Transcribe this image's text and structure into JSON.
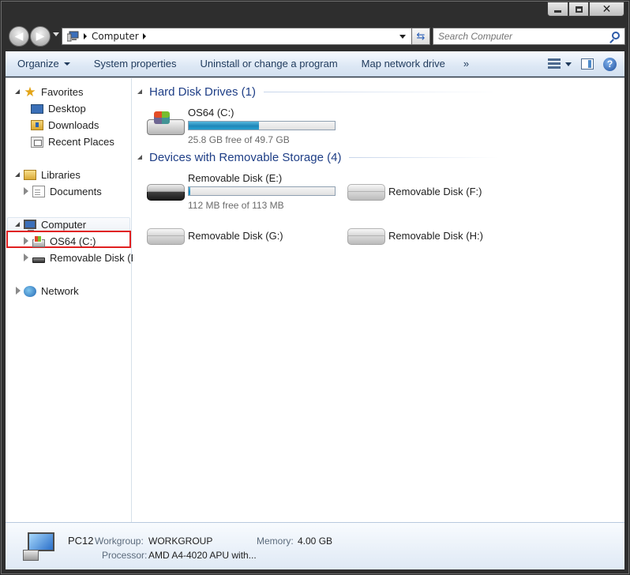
{
  "window": {
    "minimize_label": "",
    "maximize_label": "",
    "close_label": "✕"
  },
  "address": {
    "crumb": "Computer"
  },
  "search": {
    "placeholder": "Search Computer"
  },
  "toolbar": {
    "organize": "Organize",
    "system_properties": "System properties",
    "uninstall": "Uninstall or change a program",
    "map_drive": "Map network drive",
    "more": "»",
    "help": "?"
  },
  "nav": {
    "favorites": "Favorites",
    "desktop": "Desktop",
    "downloads": "Downloads",
    "recent": "Recent Places",
    "libraries": "Libraries",
    "documents": "Documents",
    "computer": "Computer",
    "os64": "OS64 (C:)",
    "removable_e": "Removable Disk (E:)",
    "network": "Network"
  },
  "groups": {
    "hdd": "Hard Disk Drives (1)",
    "removable": "Devices with Removable Storage (4)"
  },
  "drives": {
    "c": {
      "name": "OS64 (C:)",
      "free": "25.8 GB free of 49.7 GB",
      "used_fraction": 0.48
    },
    "e": {
      "name": "Removable Disk (E:)",
      "free": "112 MB free of 113 MB",
      "used_fraction": 0.01
    },
    "f": {
      "name": "Removable Disk (F:)"
    },
    "g": {
      "name": "Removable Disk (G:)"
    },
    "h": {
      "name": "Removable Disk (H:)"
    }
  },
  "details": {
    "pc_name": "PC12",
    "workgroup_label": "Workgroup:",
    "workgroup_value": "WORKGROUP",
    "memory_label": "Memory:",
    "memory_value": "4.00 GB",
    "processor_label": "Processor:",
    "processor_value": "AMD A4-4020 APU with..."
  },
  "colors": {
    "accent_red": "#e02020",
    "group_header": "#1e3e86"
  }
}
